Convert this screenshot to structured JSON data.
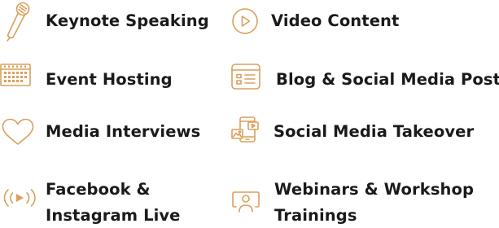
{
  "colors": {
    "accent": "#d9a05b",
    "text": "#1a1a1a"
  },
  "services": [
    {
      "label": "Keynote Speaking",
      "icon": "microphone-icon"
    },
    {
      "label": "Video Content",
      "icon": "play-circle-icon"
    },
    {
      "label": "Event Hosting",
      "icon": "calendar-icon"
    },
    {
      "label": "Blog & Social Media Posts",
      "icon": "blog-post-icon"
    },
    {
      "label": "Media Interviews",
      "icon": "heart-icon"
    },
    {
      "label": "Social Media Takeover",
      "icon": "social-media-device-icon"
    },
    {
      "label_line1": "Facebook &",
      "label_line2": "Instagram Live",
      "icon": "live-broadcast-icon"
    },
    {
      "label_line1": "Webinars & Workshop",
      "label_line2": "Trainings",
      "icon": "webinar-user-icon"
    }
  ]
}
